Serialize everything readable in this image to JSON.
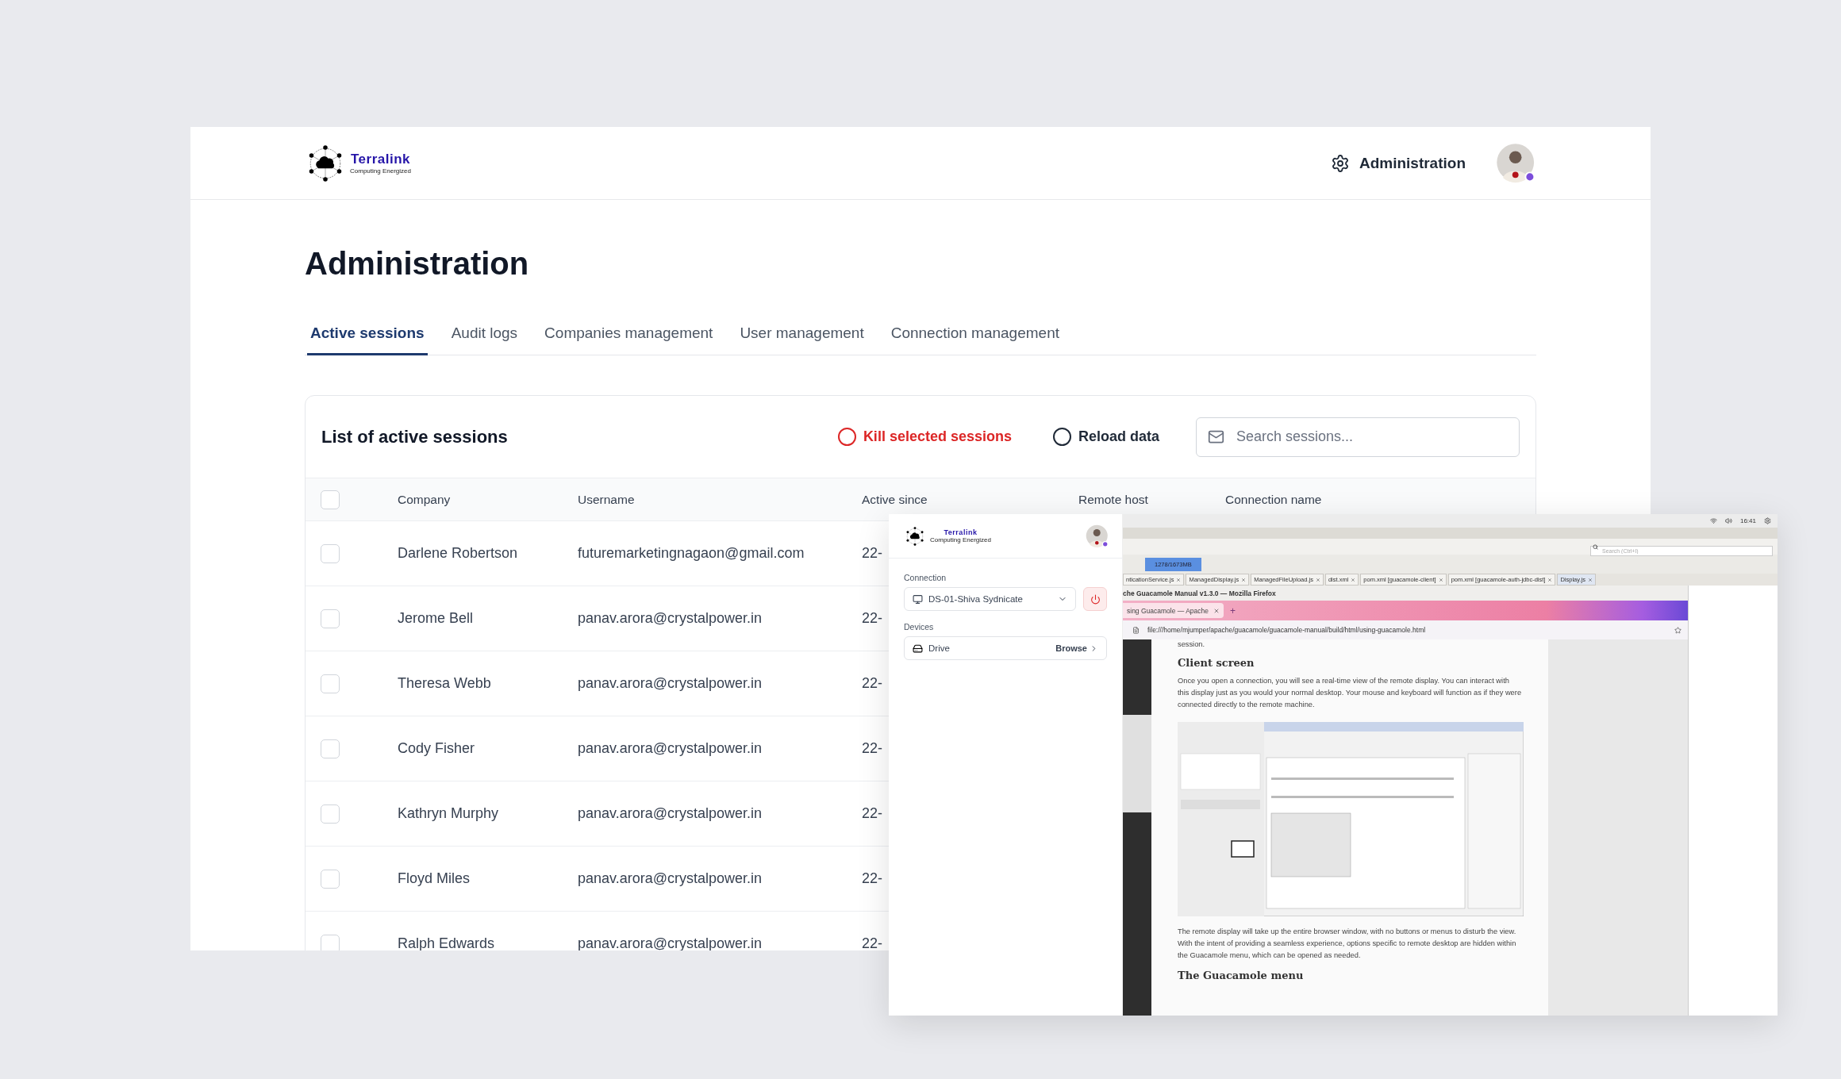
{
  "header": {
    "brand": "Terralink",
    "tagline": "Computing Energized",
    "admin_link": "Administration"
  },
  "page_title": "Administration",
  "tabs": [
    {
      "label": "Active sessions",
      "selected": true
    },
    {
      "label": "Audit logs",
      "selected": false
    },
    {
      "label": "Companies management",
      "selected": false
    },
    {
      "label": "User management",
      "selected": false
    },
    {
      "label": "Connection management",
      "selected": false
    }
  ],
  "sessions": {
    "title": "List of active sessions",
    "kill_button": "Kill selected sessions",
    "reload_button": "Reload data",
    "search": {
      "placeholder": "Search sessions..."
    },
    "all_checked": false,
    "columns": [
      "Company",
      "Username",
      "Active since",
      "Remote host",
      "Connection name"
    ],
    "rows": [
      {
        "company": "Darlene Robertson",
        "username": "futuremarketingnagaon@gmail.com",
        "active_since": "22-",
        "checked": false
      },
      {
        "company": "Jerome Bell",
        "username": "panav.arora@crystalpower.in",
        "active_since": "22-",
        "checked": false
      },
      {
        "company": "Theresa Webb",
        "username": "panav.arora@crystalpower.in",
        "active_since": "22-",
        "checked": false
      },
      {
        "company": "Cody Fisher",
        "username": "panav.arora@crystalpower.in",
        "active_since": "22-",
        "checked": false
      },
      {
        "company": "Kathryn Murphy",
        "username": "panav.arora@crystalpower.in",
        "active_since": "22-",
        "checked": false
      },
      {
        "company": "Floyd Miles",
        "username": "panav.arora@crystalpower.in",
        "active_since": "22-",
        "checked": false
      },
      {
        "company": "Ralph Edwards",
        "username": "panav.arora@crystalpower.in",
        "active_since": "22-",
        "checked": false
      }
    ]
  },
  "remote_client": {
    "sidebar": {
      "brand": "Terralink",
      "tagline": "Computing Energized",
      "connection_label": "Connection",
      "connection_value": "DS-01-Shiva Sydnicate",
      "devices_label": "Devices",
      "device_name": "Drive",
      "device_action": "Browse"
    },
    "desktop": {
      "clock": "16:41",
      "ide_search": {
        "placeholder": "Search (Ctrl+I)"
      },
      "memory": "1278/1673MB",
      "editor_tabs": [
        {
          "label": "nticationService.js",
          "selected": false
        },
        {
          "label": "ManagedDisplay.js",
          "selected": false
        },
        {
          "label": "ManagedFileUpload.js",
          "selected": false
        },
        {
          "label": "dist.xml",
          "selected": false
        },
        {
          "label": "pom.xml [guacamole-client]",
          "selected": false
        },
        {
          "label": "pom.xml [guacamole-auth-jdbc-dist]",
          "selected": false
        },
        {
          "label": "Display.js",
          "selected": true
        }
      ],
      "browser": {
        "title": "che Guacamole Manual v1.3.0 — Mozilla Firefox",
        "tab": "sing Guacamole — Apache",
        "new_tab": "+",
        "url": "file:///home/mjumper/apache/guacamole/guacamole-manual/build/html/using-guacamole.html",
        "doc": {
          "cut_line": "session.",
          "heading": "Client screen",
          "paragraph_1": "Once you open a connection, you will see a real-time view of the remote display. You can interact with this display just as you would your normal desktop. Your mouse and keyboard will function as if they were connected directly to the remote machine.",
          "paragraph_2": "The remote display will take up the entire browser window, with no buttons or menus to disturb the view. With the intent of providing a seamless experience, options specific to remote desktop are hidden within the Guacamole menu, which can be opened as needed.",
          "heading_2": "The Guacamole menu"
        }
      }
    }
  }
}
